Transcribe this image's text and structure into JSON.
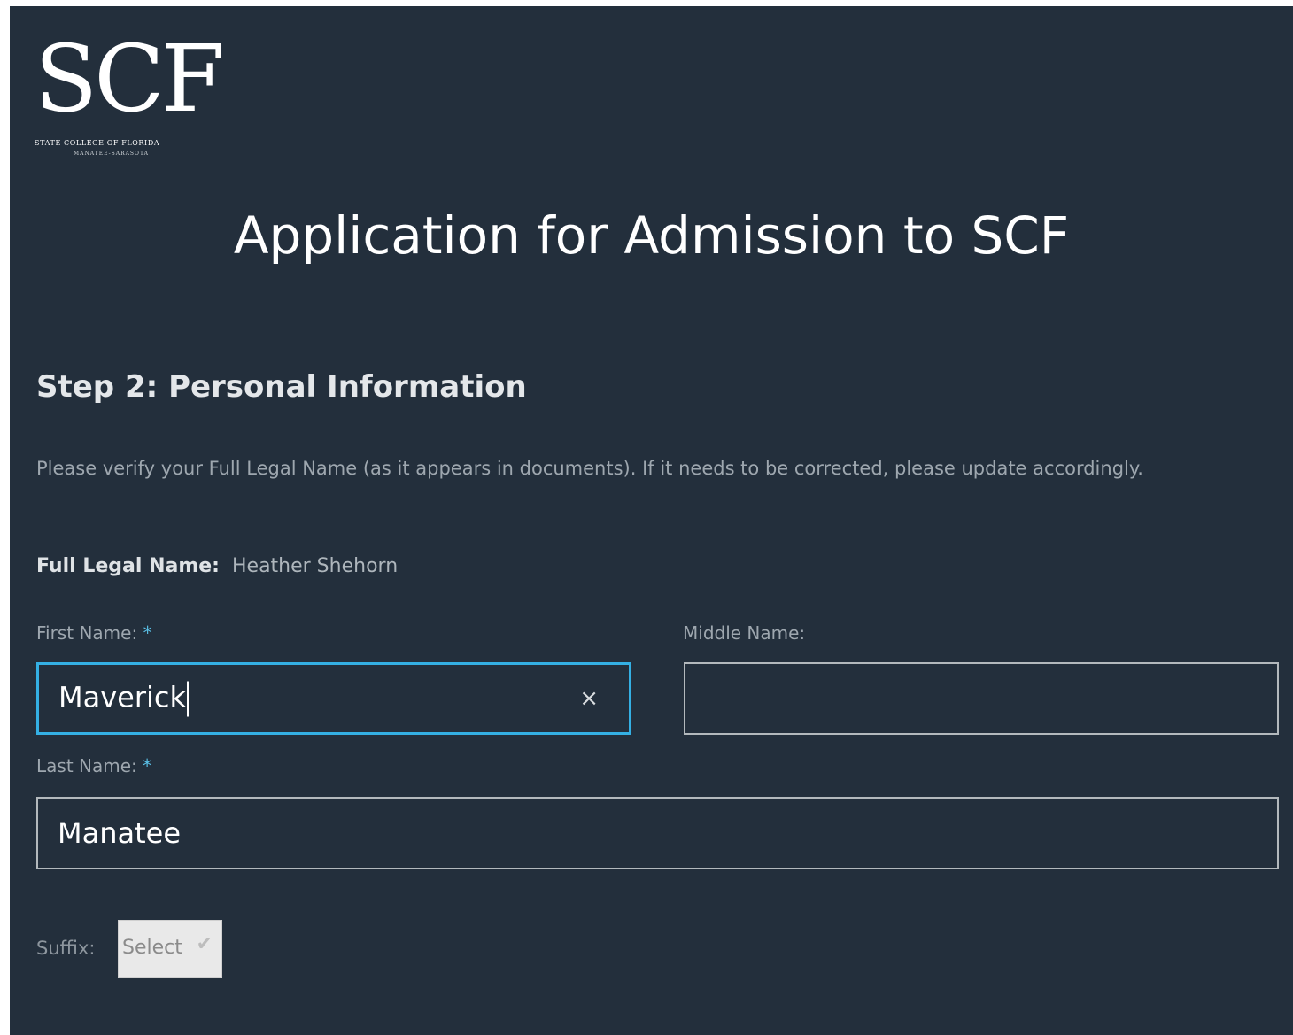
{
  "logo": {
    "mark": "SCF",
    "line1": "STATE COLLEGE OF FLORIDA",
    "line2": "MANATEE-SARASOTA"
  },
  "page_title": "Application for Admission to SCF",
  "step": {
    "heading": "Step 2: Personal Information",
    "instructions": "Please verify your Full Legal Name (as it appears in documents). If it needs to be corrected, please update accordingly."
  },
  "full_legal_name": {
    "label": "Full Legal Name:",
    "value": "Heather Shehorn"
  },
  "fields": {
    "first_name": {
      "label": "First Name:",
      "required_mark": "*",
      "value": "Maverick",
      "clear_icon": "×"
    },
    "middle_name": {
      "label": "Middle Name:",
      "value": ""
    },
    "last_name": {
      "label": "Last Name:",
      "required_mark": "*",
      "value": "Manatee"
    }
  },
  "suffix": {
    "label": "Suffix:",
    "selected": "Select",
    "chevron_icon": "chevron-down-icon"
  },
  "colors": {
    "background": "#232f3c",
    "focus_border": "#34b0e4",
    "field_border": "#b3b9bd"
  }
}
